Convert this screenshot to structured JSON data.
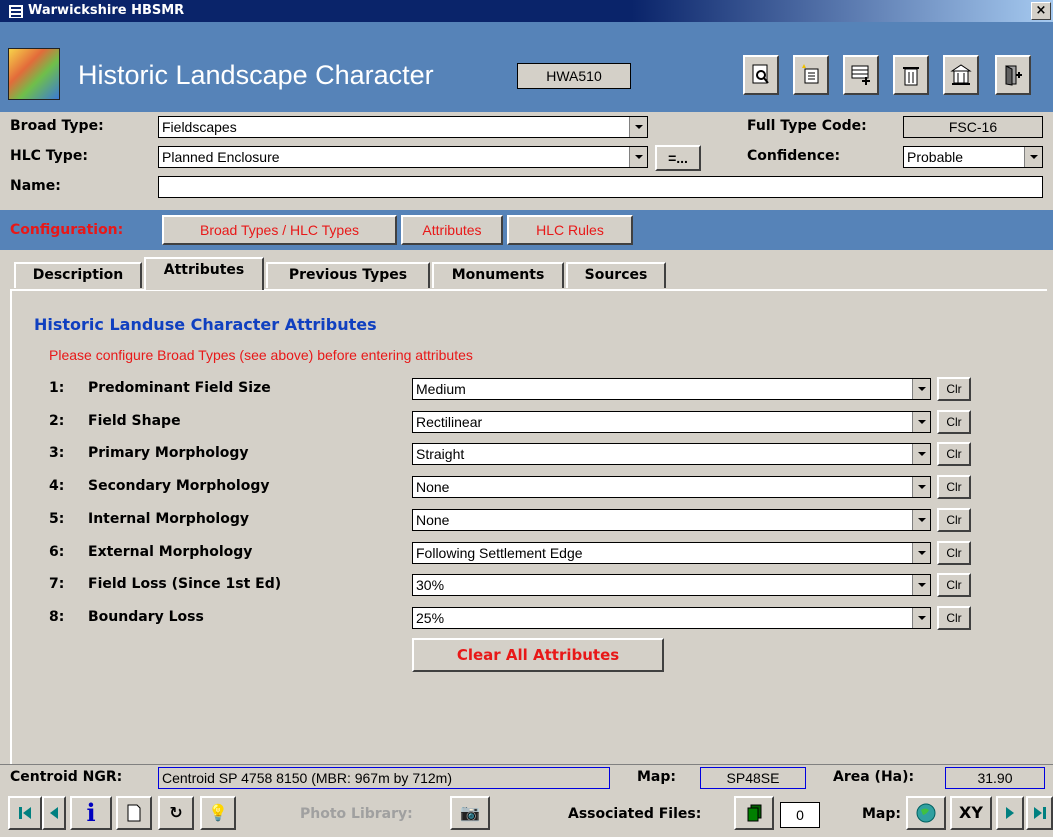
{
  "window": {
    "title": "Warwickshire HBSMR",
    "close": "×"
  },
  "header": {
    "title": "Historic Landscape Character",
    "record_id": "HWA510"
  },
  "form": {
    "broad_type_label": "Broad Type:",
    "broad_type_value": "Fieldscapes",
    "hlc_type_label": "HLC Type:",
    "hlc_type_value": "Planned Enclosure",
    "hlc_type_button": "=...",
    "name_label": "Name:",
    "name_value": "",
    "full_type_code_label": "Full Type Code:",
    "full_type_code_value": "FSC-16",
    "confidence_label": "Confidence:",
    "confidence_value": "Probable"
  },
  "configuration": {
    "label": "Configuration:",
    "buttons": [
      "Broad Types / HLC Types",
      "Attributes",
      "HLC Rules"
    ]
  },
  "tabs": [
    "Description",
    "Attributes",
    "Previous Types",
    "Monuments",
    "Sources"
  ],
  "active_tab": "Attributes",
  "attributes": {
    "title": "Historic Landuse Character Attributes",
    "warning": "Please configure Broad Types (see above) before entering attributes",
    "clr_label": "Clr",
    "clear_all_label": "Clear All Attributes",
    "rows": [
      {
        "num": "1:",
        "name": "Predominant Field Size",
        "value": "Medium"
      },
      {
        "num": "2:",
        "name": "Field Shape",
        "value": "Rectilinear"
      },
      {
        "num": "3:",
        "name": "Primary Morphology",
        "value": "Straight"
      },
      {
        "num": "4:",
        "name": "Secondary Morphology",
        "value": "None"
      },
      {
        "num": "5:",
        "name": "Internal Morphology",
        "value": "None"
      },
      {
        "num": "6:",
        "name": "External Morphology",
        "value": "Following Settlement Edge"
      },
      {
        "num": "7:",
        "name": "Field Loss (Since 1st Ed)",
        "value": "30%"
      },
      {
        "num": "8:",
        "name": "Boundary Loss",
        "value": "25%"
      }
    ]
  },
  "status": {
    "centroid_label": "Centroid NGR:",
    "centroid_value": "Centroid SP 4758 8150  (MBR: 967m by 712m)",
    "map_label": "Map:",
    "map_value": "SP48SE",
    "area_label": "Area (Ha):",
    "area_value": "31.90"
  },
  "nav": {
    "photo_library_label": "Photo Library:",
    "associated_files_label": "Associated Files:",
    "associated_files_count": "0",
    "map_label": "Map:",
    "xy_label": "XY"
  },
  "icons": [
    "print-preview-icon",
    "new-record-icon",
    "add-row-icon",
    "delete-icon",
    "building-icon",
    "exit-icon",
    "first-record-icon",
    "previous-record-icon",
    "info-icon",
    "new-page-icon",
    "refresh-icon",
    "lightbulb-icon",
    "camera-icon",
    "files-icon",
    "globe-icon",
    "next-record-icon",
    "last-record-icon"
  ]
}
